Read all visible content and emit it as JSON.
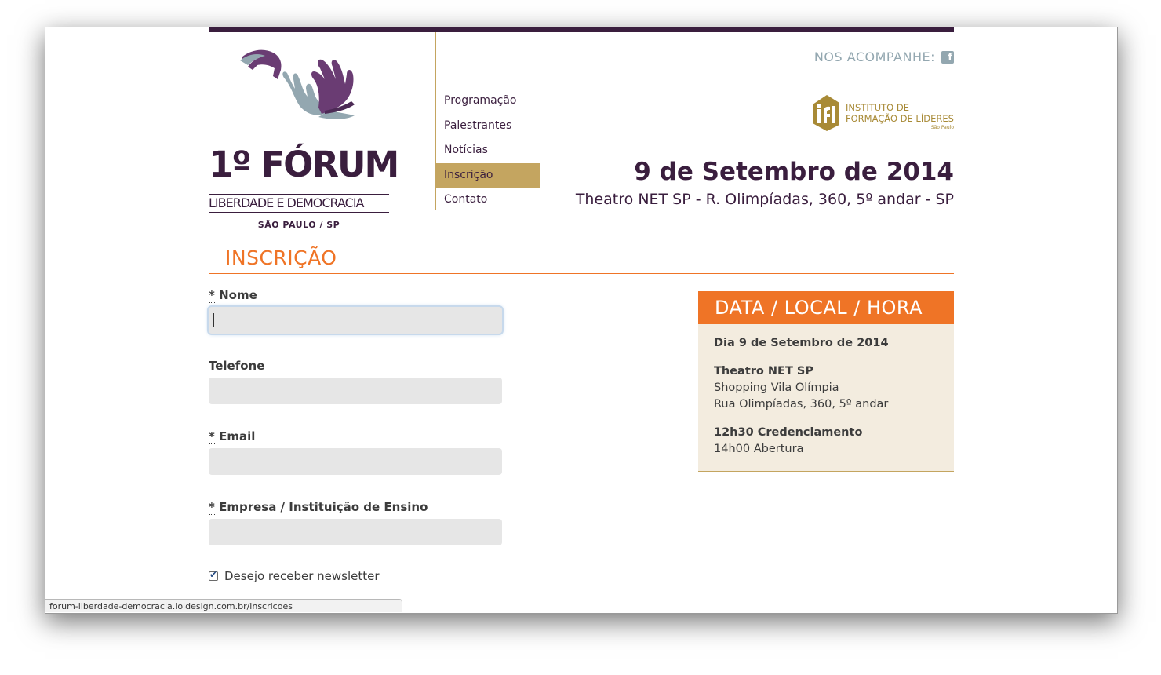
{
  "logo": {
    "title": "1º FÓRUM",
    "subtitle": "LIBERDADE E DEMOCRACIA",
    "city": "SÃO PAULO / SP"
  },
  "nav": {
    "items": [
      {
        "label": "Programação"
      },
      {
        "label": "Palestrantes"
      },
      {
        "label": "Notícias"
      },
      {
        "label": "Inscrição"
      },
      {
        "label": "Contato"
      }
    ],
    "active_index": 3
  },
  "header": {
    "follow_label": "NOS ACOMPANHE:",
    "follow_icon": "facebook-icon",
    "partner": {
      "line1": "INSTITUTO DE",
      "line2": "FORMAÇÃO DE LÍDERES",
      "small": "São Paulo"
    },
    "event_date": "9 de Setembro de 2014",
    "event_place": "Theatro NET SP - R. Olimpíadas, 360, 5º andar - SP"
  },
  "section": {
    "title": "INSCRIÇÃO"
  },
  "form": {
    "name": {
      "required_mark": "*",
      "label": "Nome",
      "value": ""
    },
    "phone": {
      "label": "Telefone",
      "value": ""
    },
    "email": {
      "required_mark": "*",
      "label": "Email",
      "value": ""
    },
    "company": {
      "required_mark": "*",
      "label": "Empresa / Instituição de Ensino",
      "value": ""
    },
    "newsletter": {
      "label": "Desejo receber newsletter",
      "checked": true
    }
  },
  "infobox": {
    "title": "DATA / LOCAL / HORA",
    "date": "Dia 9 de Setembro de 2014",
    "venue": "Theatro NET SP",
    "venue_line2": "Shopping Vila Olímpia",
    "venue_line3": "Rua Olimpíadas, 360, 5º andar",
    "time1": "12h30 Credenciamento",
    "time2": "14h00 Abertura"
  },
  "statusbar": {
    "url": "forum-liberdade-democracia.loldesign.com.br/inscricoes"
  },
  "colors": {
    "brand_purple": "#3a1e3e",
    "gold": "#c4a560",
    "orange": "#ef7426",
    "slate_blue": "#93a7b0"
  }
}
